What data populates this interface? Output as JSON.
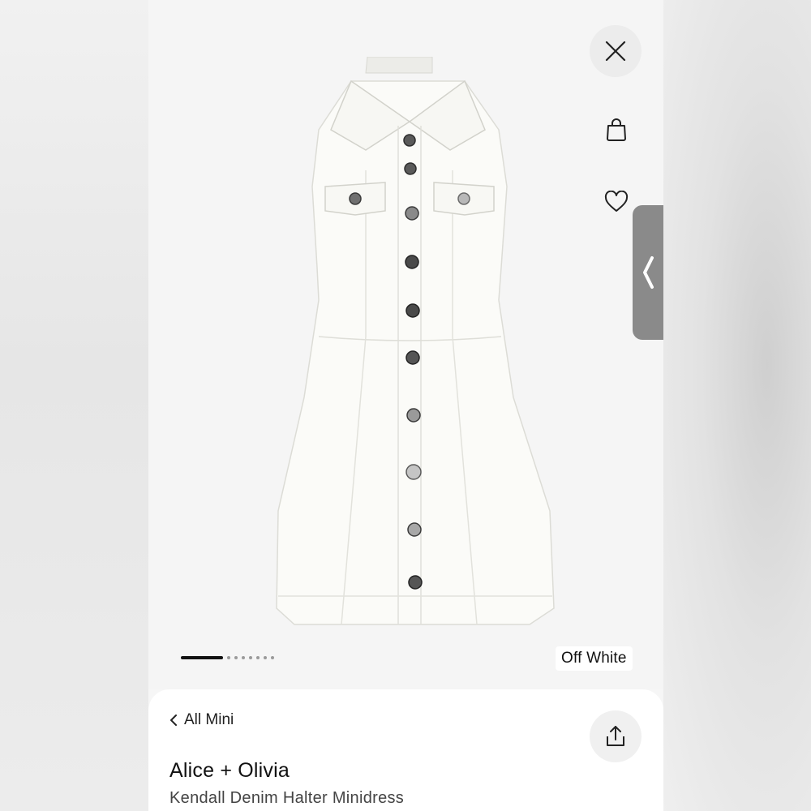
{
  "header": {
    "close_icon": "close-icon",
    "bag_icon": "shopping-bag-icon",
    "favorite_icon": "heart-icon",
    "side_handle_icon": "chevron-left-icon"
  },
  "gallery": {
    "image_count": 8,
    "active_index": 0,
    "color_label": "Off White"
  },
  "details": {
    "breadcrumb_label": "All Mini",
    "breadcrumb_icon": "chevron-left-icon",
    "share_icon": "share-icon",
    "brand": "Alice + Olivia",
    "product_name": "Kendall Denim Halter Minidress"
  },
  "colors": {
    "accent": "#111111",
    "handle": "#8a8a8a",
    "dress": "#fbfbf8"
  }
}
